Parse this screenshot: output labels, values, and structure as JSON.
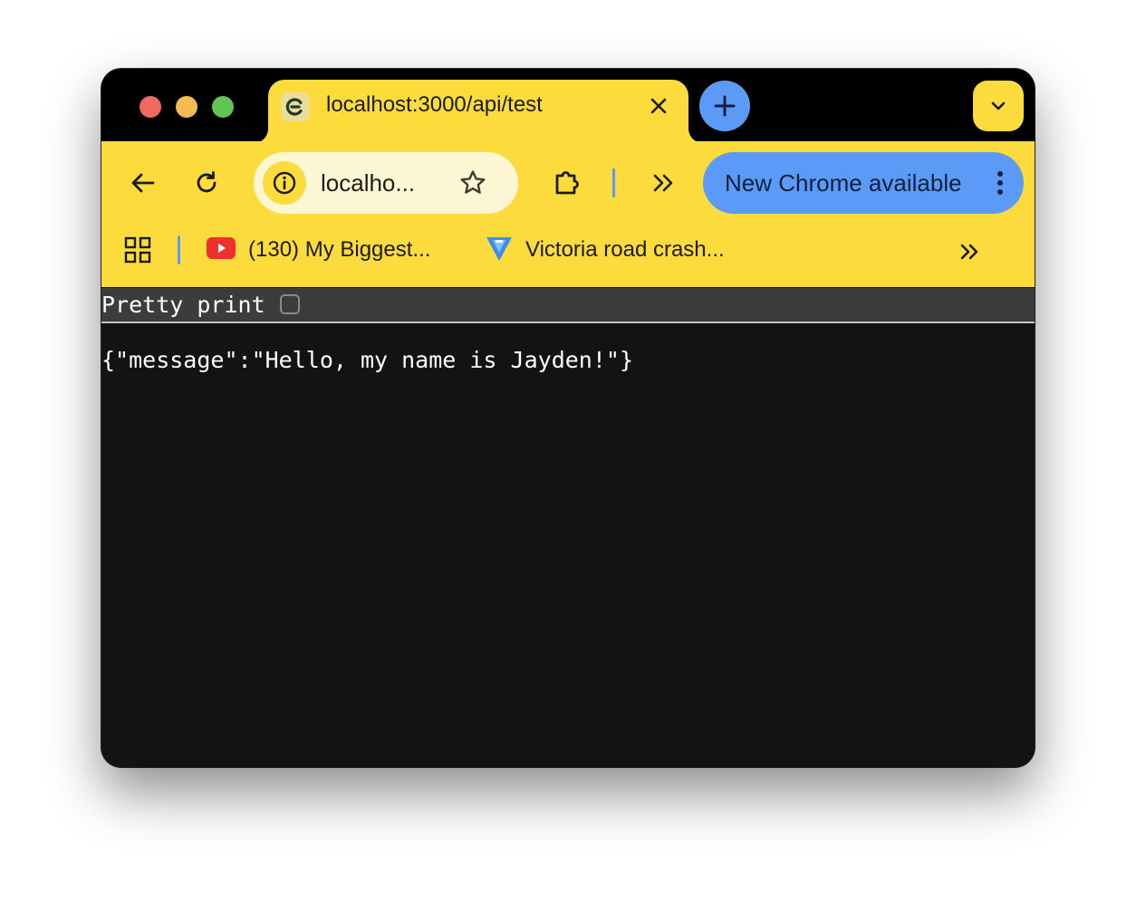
{
  "tab": {
    "title": "localhost:3000/api/test",
    "favicon": "c-letter-icon"
  },
  "toolbar": {
    "omnibox_text": "localho...",
    "update_label": "New Chrome available"
  },
  "bookmarks": [
    {
      "label": "(130) My Biggest...",
      "icon": "youtube-icon"
    },
    {
      "label": "Victoria road crash...",
      "icon": "news-site-icon"
    }
  ],
  "viewer": {
    "pretty_print_label": "Pretty print",
    "pretty_print_checked": false,
    "body": "{\"message\":\"Hello, my name is Jayden!\"}"
  },
  "colors": {
    "theme": "#fbdc3c",
    "accent": "#5b9af7",
    "content_bg": "#131313"
  }
}
